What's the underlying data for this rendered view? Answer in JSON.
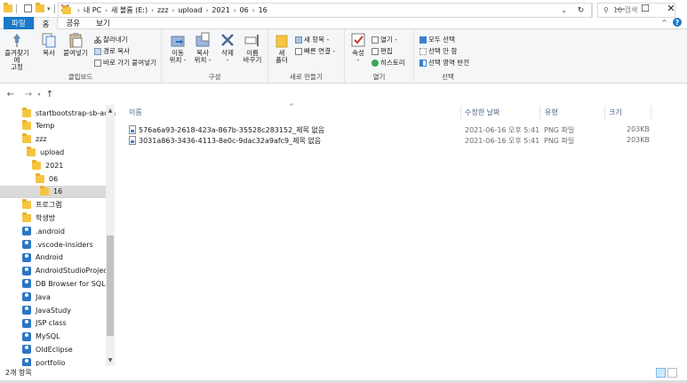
{
  "window": {
    "title": "16",
    "minimize": "—",
    "maximize": "☐",
    "close": "✕"
  },
  "ribbon_tabs": [
    "파일",
    "홈",
    "공유",
    "보기"
  ],
  "ribbon": {
    "clipboard": {
      "label": "클립보드",
      "pin": "즐겨찾기에\n고정",
      "copy": "복사",
      "paste": "붙여넣기",
      "cut": "잘라내기",
      "copy_path": "경로 복사",
      "paste_shortcut": "바로 가기 붙여넣기"
    },
    "organize": {
      "label": "구성",
      "move_to": "이동\n위치 -",
      "copy_to": "복사\n위치 -",
      "delete": "삭제\n-",
      "rename": "이름\n바꾸기"
    },
    "new": {
      "label": "새로 만들기",
      "new_folder": "새\n폴더",
      "new_item": "새 항목 -",
      "easy_access": "빠른 연결 -"
    },
    "open": {
      "label": "열기",
      "properties": "속성\n-",
      "open": "열기 -",
      "edit": "편집",
      "history": "히스토리"
    },
    "select": {
      "label": "선택",
      "select_all": "모두 선택",
      "select_none": "선택 안 함",
      "invert": "선택 영역 반전"
    }
  },
  "address": {
    "crumbs": [
      "내 PC",
      "새 볼륨 (E:)",
      "zzz",
      "upload",
      "2021",
      "06",
      "16"
    ],
    "search_placeholder": "16 검색"
  },
  "nav_items": [
    {
      "label": "startbootstrap-sb-admin",
      "type": "folder"
    },
    {
      "label": "Temp",
      "type": "folder"
    },
    {
      "label": "zzz",
      "type": "folder"
    },
    {
      "label": "upload",
      "type": "folder"
    },
    {
      "label": "2021",
      "type": "folder"
    },
    {
      "label": "06",
      "type": "folder"
    },
    {
      "label": "16",
      "type": "folder",
      "selected": true
    },
    {
      "label": "프로그램",
      "type": "folder"
    },
    {
      "label": "학생방",
      "type": "folder"
    },
    {
      "label": ".android",
      "type": "user"
    },
    {
      "label": ".vscode-insiders",
      "type": "user"
    },
    {
      "label": "Android",
      "type": "user"
    },
    {
      "label": "AndroidStudioProjects",
      "type": "user"
    },
    {
      "label": "DB Browser for SQLite",
      "type": "user"
    },
    {
      "label": "Java",
      "type": "user"
    },
    {
      "label": "JavaStudy",
      "type": "user"
    },
    {
      "label": "JSP class",
      "type": "user"
    },
    {
      "label": "MySQL",
      "type": "user"
    },
    {
      "label": "OldEclipse",
      "type": "user"
    },
    {
      "label": "portfolio",
      "type": "user"
    }
  ],
  "columns": {
    "name": "이름",
    "modified": "수정한 날짜",
    "type": "유형",
    "size": "크기"
  },
  "files": [
    {
      "name": "576a6a93-2618-423a-867b-35528c283152_제목 없음",
      "modified": "2021-06-16 오후 5:41",
      "type": "PNG 파일",
      "size": "203KB"
    },
    {
      "name": "3031a863-3436-4113-8e0c-9dac32a9afc9_제목 없음",
      "modified": "2021-06-16 오후 5:41",
      "type": "PNG 파일",
      "size": "203KB"
    }
  ],
  "status": {
    "count": "2개 항목"
  },
  "colors": {
    "accent": "#1979ca",
    "folder": "#f5c542",
    "selection": "#d9d9d9"
  }
}
